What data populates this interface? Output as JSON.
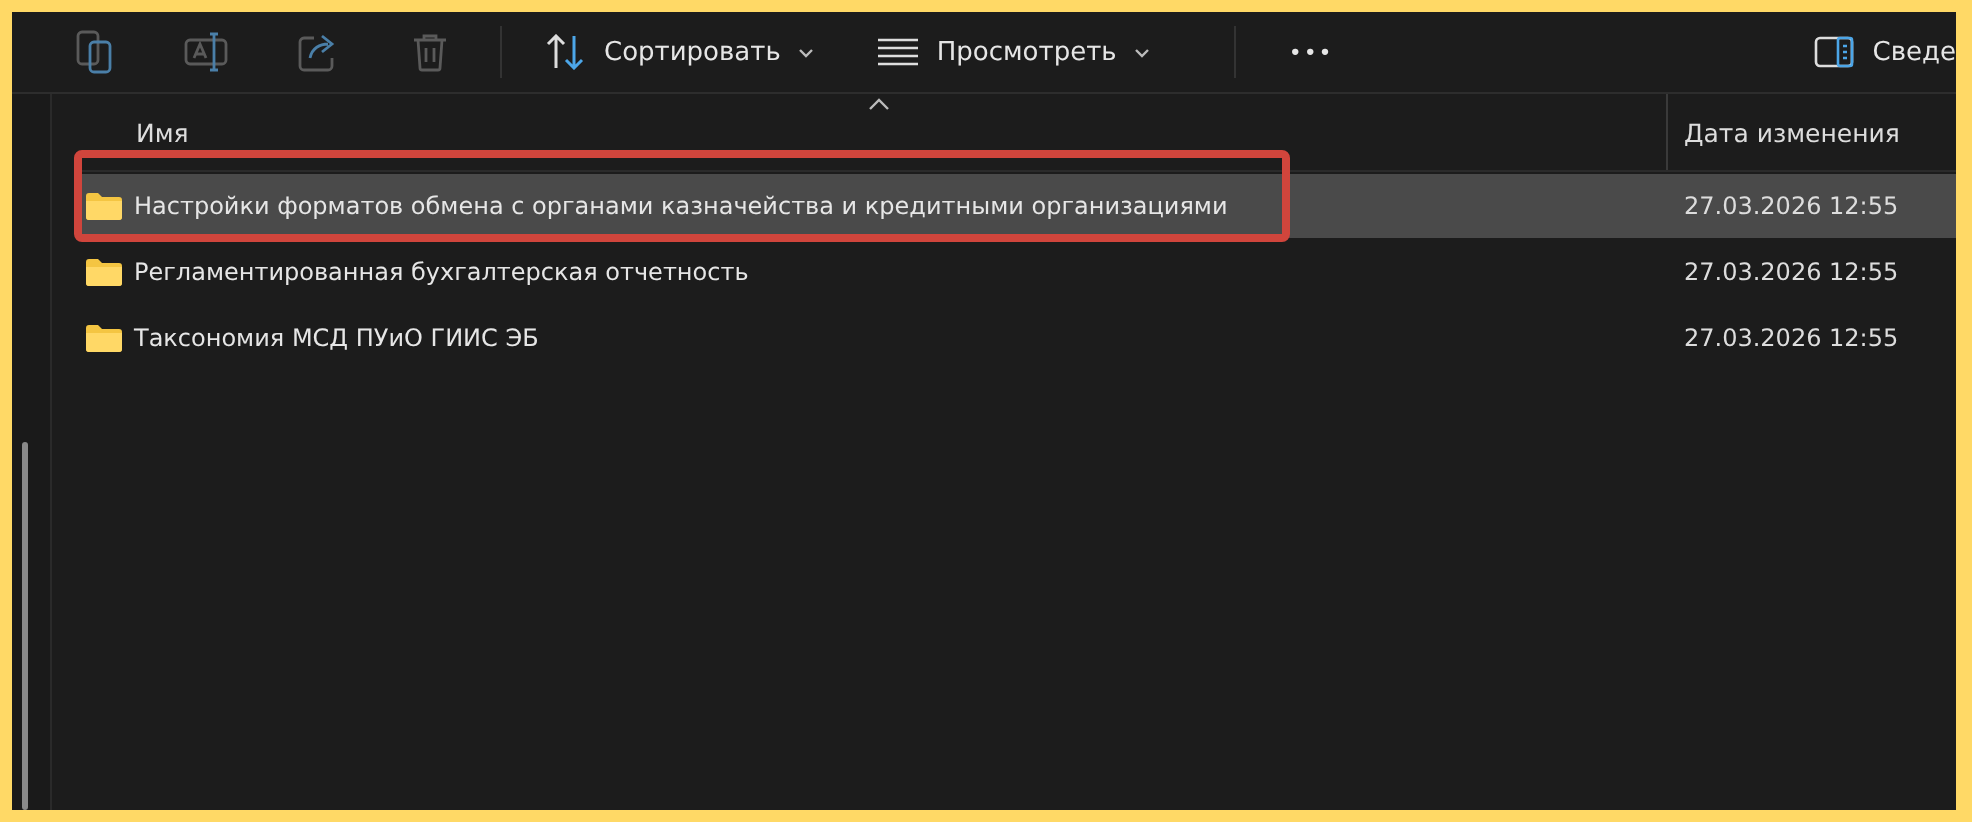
{
  "toolbar": {
    "actions": [
      {
        "kind": "copy",
        "disabled": true
      },
      {
        "kind": "rename",
        "disabled": true
      },
      {
        "kind": "share",
        "disabled": true
      },
      {
        "kind": "delete",
        "disabled": true
      }
    ],
    "sort_button": {
      "label": "Сортировать"
    },
    "view_button": {
      "label": "Просмотреть"
    },
    "more_button": {
      "label": "•••"
    },
    "details_button": {
      "label": "Сведе"
    }
  },
  "table": {
    "columns": [
      {
        "label": "Имя",
        "sorted": true
      },
      {
        "label": "Дата изменения",
        "sorted": false
      }
    ],
    "rows": [
      {
        "name": "Настройки форматов обмена с органами казначейства и кредитными организациями",
        "date": "27.03.2026 12:55",
        "selected": true,
        "annotated": true
      },
      {
        "name": "Регламентированная бухгалтерская отчетность",
        "date": "27.03.2026 12:55",
        "selected": false,
        "annotated": false
      },
      {
        "name": "Таксономия МСД ПУиО ГИИС ЭБ",
        "date": "27.03.2026 12:55",
        "selected": false,
        "annotated": false
      }
    ]
  }
}
